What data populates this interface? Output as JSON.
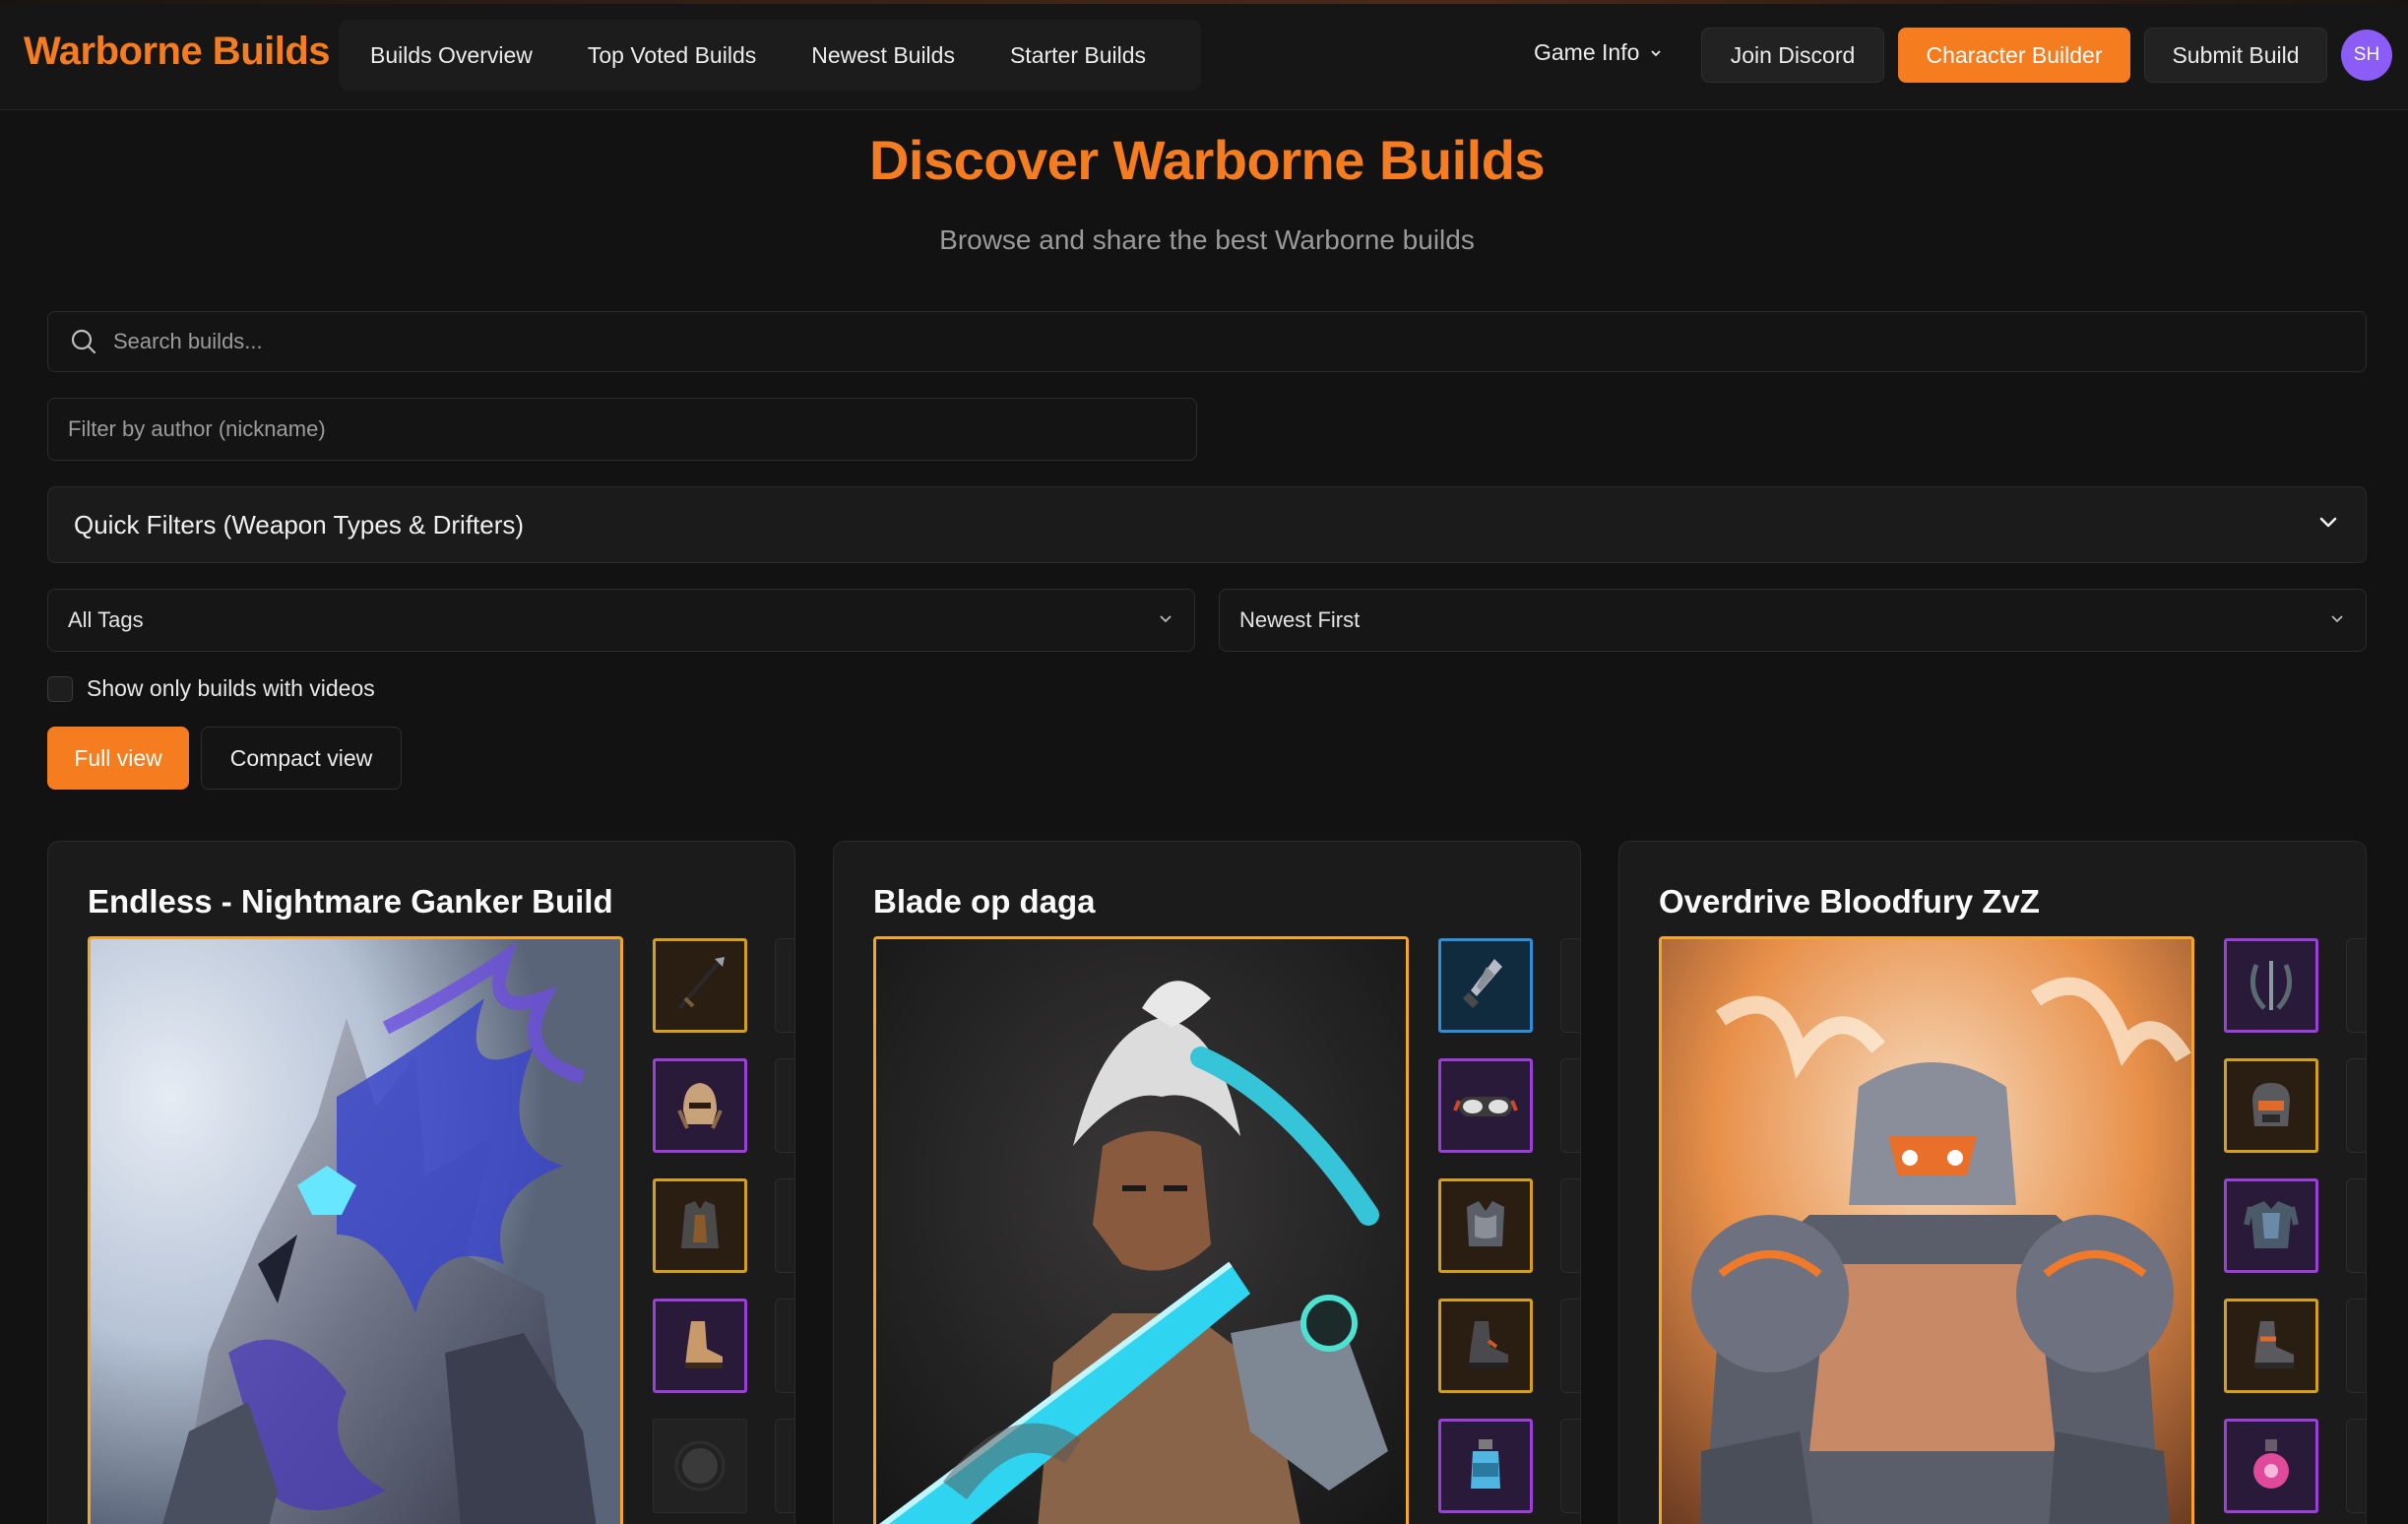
{
  "nav": {
    "brand": "Warborne Builds",
    "links": [
      "Builds Overview",
      "Top Voted Builds",
      "Newest Builds",
      "Starter Builds"
    ],
    "game_info": "Game Info",
    "join_discord": "Join Discord",
    "character_builder": "Character Builder",
    "submit_build": "Submit Build",
    "avatar_initials": "SH"
  },
  "header": {
    "title": "Discover Warborne Builds",
    "subtitle": "Browse and share the best Warborne builds"
  },
  "filters": {
    "search_placeholder": "Search builds...",
    "author_placeholder": "Filter by author (nickname)",
    "quick_filters_label": "Quick Filters (Weapon Types & Drifters)",
    "tags_selected": "All Tags",
    "sort_selected": "Newest First",
    "videos_only_label": "Show only builds with videos",
    "videos_only_checked": false,
    "view_full_label": "Full view",
    "view_compact_label": "Compact view",
    "active_view": "full"
  },
  "colors": {
    "accent": "#f57c1f",
    "background": "#121212",
    "card": "#1b1b1b",
    "avatar": "#8b5cf6",
    "rarity_gold": "#d4a017",
    "rarity_purple": "#9b3fd8",
    "rarity_blue": "#2f8fd6"
  },
  "builds": [
    {
      "title": "Endless - Nightmare Ganker Build",
      "portrait": "armored-knight-portrait",
      "slots": [
        {
          "icon": "spear-icon",
          "rarity": "gold"
        },
        {
          "icon": "helmet-icon",
          "rarity": "purple"
        },
        {
          "icon": "chest-armor-icon",
          "rarity": "gold"
        },
        {
          "icon": "boots-icon",
          "rarity": "purple"
        },
        {
          "icon": "empty-slot-icon",
          "rarity": "empty"
        }
      ]
    },
    {
      "title": "Blade op daga",
      "portrait": "rogue-swordsman-portrait",
      "slots": [
        {
          "icon": "dagger-icon",
          "rarity": "blue"
        },
        {
          "icon": "goggles-icon",
          "rarity": "purple"
        },
        {
          "icon": "chest-armor-icon",
          "rarity": "gold"
        },
        {
          "icon": "boots-icon",
          "rarity": "gold"
        },
        {
          "icon": "potion-bottle-icon",
          "rarity": "purple"
        }
      ]
    },
    {
      "title": "Overdrive Bloodfury ZvZ",
      "portrait": "mech-brute-portrait",
      "slots": [
        {
          "icon": "scythe-icon",
          "rarity": "purple"
        },
        {
          "icon": "mask-helmet-icon",
          "rarity": "gold"
        },
        {
          "icon": "chest-armor-icon",
          "rarity": "purple"
        },
        {
          "icon": "boots-icon",
          "rarity": "gold"
        },
        {
          "icon": "potion-flask-icon",
          "rarity": "purple"
        }
      ]
    }
  ]
}
